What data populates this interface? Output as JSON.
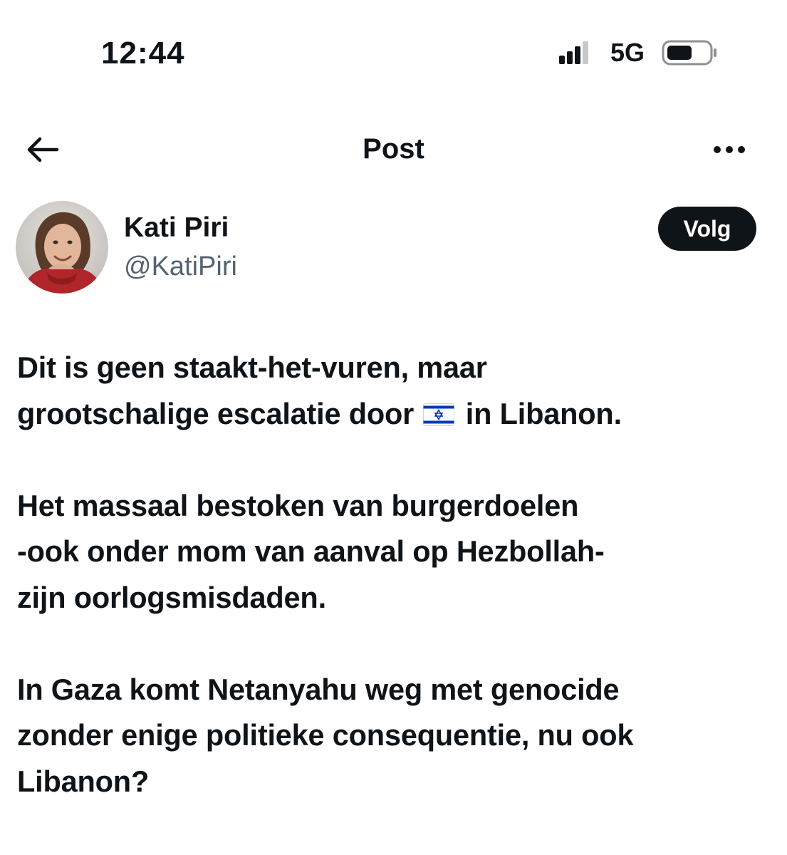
{
  "status_bar": {
    "time": "12:44",
    "network": "5G",
    "signal_icon": "cellular-signal-icon",
    "battery_icon": "battery-icon"
  },
  "header": {
    "title": "Post",
    "back_icon": "arrow-left-icon",
    "more_icon": "more-horizontal-icon"
  },
  "author": {
    "name": "Kati Piri",
    "handle": "@KatiPiri",
    "follow_label": "Volg"
  },
  "post": {
    "line1": "Dit is geen staakt-het-vuren, maar",
    "line2_before_flag": "grootschalige escalatie door",
    "flag_icon": "israel-flag-icon",
    "line2_after_flag": " in Libanon.",
    "line3": "Het massaal bestoken van burgerdoelen",
    "line4": "-ook onder mom van aanval op Hezbollah-",
    "line5": "zijn oorlogsmisdaden.",
    "line6": "In Gaza komt Netanyahu weg met genocide",
    "line7": "zonder enige politieke consequentie, nu ook",
    "line8": "Libanon?"
  },
  "colors": {
    "text": "#0f1419",
    "secondary_text": "#536471",
    "follow_button_bg": "#0f1419",
    "flag_blue": "#0038b8"
  }
}
